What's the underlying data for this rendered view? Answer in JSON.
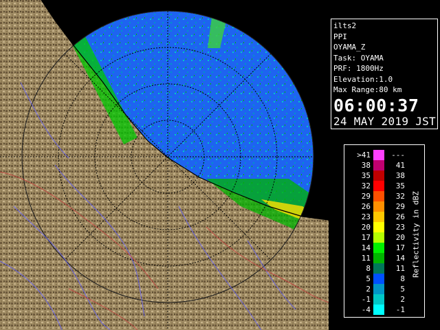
{
  "info": {
    "system": "ilts2",
    "scan_type": "PPI",
    "product": "OYAMA_Z",
    "task": "Task: OYAMA",
    "prf": "PRF: 1800Hz",
    "elevation": "Elevation:1.0",
    "max_range": "Max Range:80 km",
    "time": "06:00:37",
    "date": "24 MAY 2019 JST"
  },
  "legend": {
    "unit_label": "Reflectivity in dBZ",
    "rows": [
      {
        "low": ">41",
        "high": "---",
        "color": "#ff40ff"
      },
      {
        "low": "38",
        "high": "41",
        "color": "#c00070"
      },
      {
        "low": "35",
        "high": "38",
        "color": "#c00000"
      },
      {
        "low": "32",
        "high": "35",
        "color": "#ff0000"
      },
      {
        "low": "29",
        "high": "32",
        "color": "#ff5000"
      },
      {
        "low": "26",
        "high": "29",
        "color": "#ff9000"
      },
      {
        "low": "23",
        "high": "26",
        "color": "#ffc800"
      },
      {
        "low": "20",
        "high": "23",
        "color": "#ffff00"
      },
      {
        "low": "17",
        "high": "20",
        "color": "#b4ff00"
      },
      {
        "low": "14",
        "high": "17",
        "color": "#00f000"
      },
      {
        "low": "11",
        "high": "14",
        "color": "#00b400"
      },
      {
        "low": "8",
        "high": "11",
        "color": "#00785a"
      },
      {
        "low": "5",
        "high": "8",
        "color": "#0050ff"
      },
      {
        "low": "2",
        "high": "5",
        "color": "#0096c8"
      },
      {
        "low": "-1",
        "high": "2",
        "color": "#00c8c8"
      },
      {
        "low": "-4",
        "high": "-1",
        "color": "#00ffff"
      }
    ]
  },
  "colors": {
    "background": "#000000",
    "land": "#a08c64",
    "sea_echo": "#1450e6",
    "range_ring": "#000000"
  }
}
